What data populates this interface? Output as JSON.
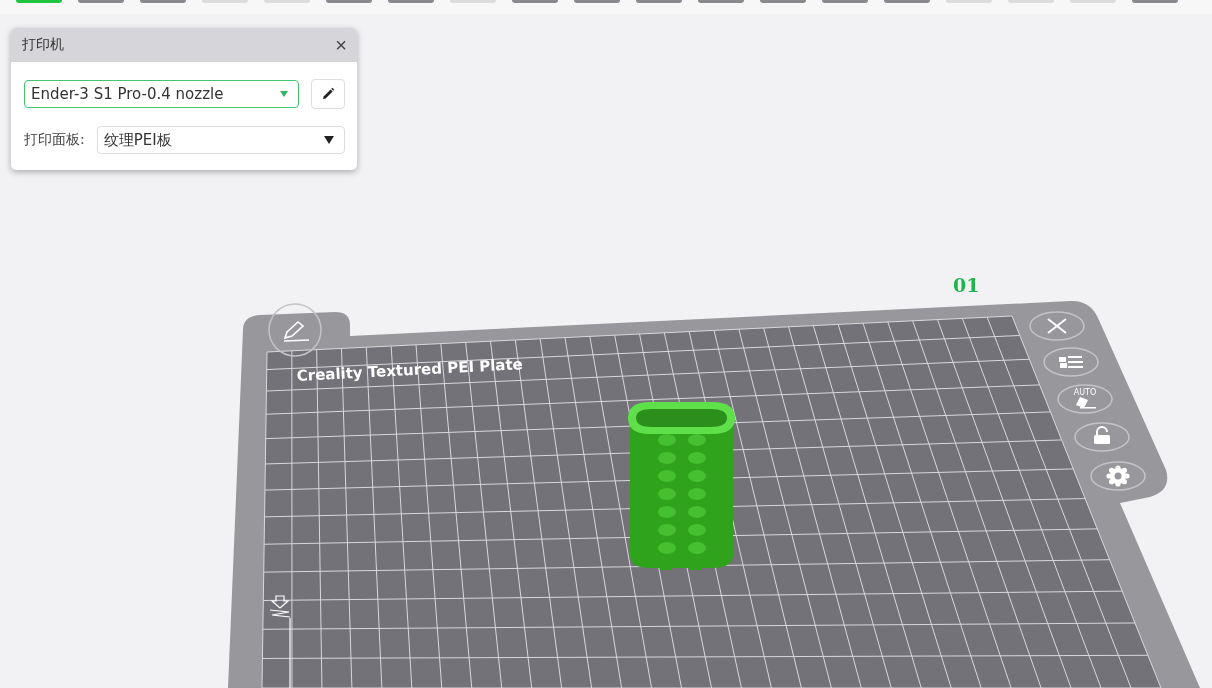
{
  "toolbar": [
    {
      "selected": true,
      "disabled": false
    },
    {
      "selected": false,
      "disabled": false
    },
    {
      "selected": false,
      "disabled": false
    },
    {
      "selected": false,
      "disabled": true
    },
    {
      "selected": false,
      "disabled": true
    },
    {
      "selected": false,
      "disabled": false
    },
    {
      "selected": false,
      "disabled": false
    },
    {
      "selected": false,
      "disabled": true
    },
    {
      "selected": false,
      "disabled": false
    },
    {
      "selected": false,
      "disabled": false
    },
    {
      "selected": false,
      "disabled": false
    },
    {
      "selected": false,
      "disabled": false
    },
    {
      "selected": false,
      "disabled": false
    },
    {
      "selected": false,
      "disabled": false
    },
    {
      "selected": false,
      "disabled": false
    },
    {
      "selected": false,
      "disabled": true
    },
    {
      "selected": false,
      "disabled": true
    },
    {
      "selected": false,
      "disabled": true
    },
    {
      "selected": false,
      "disabled": false
    }
  ],
  "printer_panel": {
    "title": "打印机",
    "close": "×",
    "printer_select": {
      "value": "Ender-3 S1 Pro-0.4 nozzle",
      "focused": true
    },
    "bed_label": "打印面板:",
    "bed_select": {
      "value": "纹理PEI板"
    }
  },
  "plate": {
    "label": "Creality Textured PEI Plate",
    "number": "01",
    "buttons": [
      {
        "kind": "close"
      },
      {
        "kind": "list"
      },
      {
        "kind": "auto",
        "label": "AUTO"
      },
      {
        "kind": "lock"
      },
      {
        "kind": "settings"
      }
    ]
  }
}
